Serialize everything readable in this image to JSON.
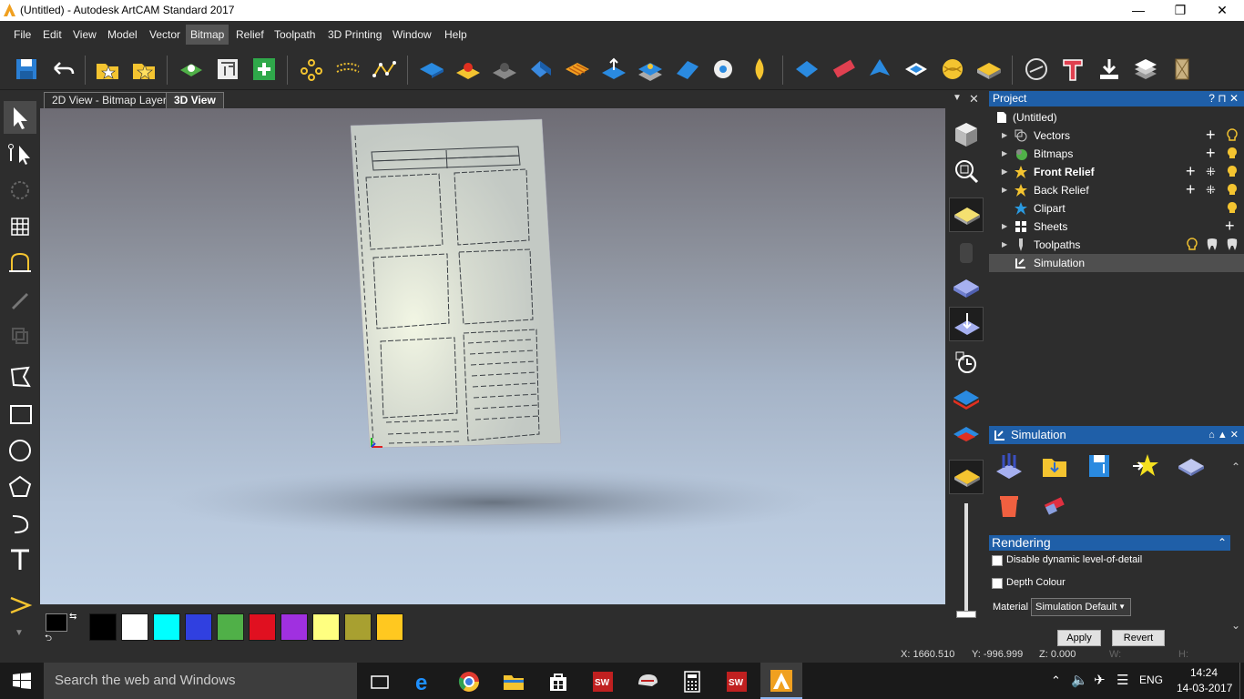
{
  "window": {
    "title": "(Untitled) - Autodesk ArtCAM Standard 2017",
    "minimize": "—",
    "restore": "❐",
    "close": "✕"
  },
  "menu": [
    "File",
    "Edit",
    "View",
    "Model",
    "Vector",
    "Bitmap",
    "Relief",
    "Toolpath",
    "3D Printing",
    "Window",
    "Help"
  ],
  "menu_selected": "Bitmap",
  "tabs": [
    {
      "label": "2D View - Bitmap Layer"
    },
    {
      "label": "3D View"
    }
  ],
  "project": {
    "title": "Project",
    "controls": "? ⊓ ✕",
    "items": [
      {
        "label": "(Untitled)"
      },
      {
        "label": "Vectors"
      },
      {
        "label": "Bitmaps"
      },
      {
        "label": "Front Relief"
      },
      {
        "label": "Back Relief"
      },
      {
        "label": "Clipart"
      },
      {
        "label": "Sheets"
      },
      {
        "label": "Toolpaths"
      },
      {
        "label": "Simulation"
      }
    ]
  },
  "simulation": {
    "title": "Simulation",
    "rendering_title": "Rendering",
    "disable_lod": "Disable dynamic level-of-detail",
    "depth_colour": "Depth Colour",
    "material_label": "Material",
    "material_value": "Simulation Default",
    "apply": "Apply",
    "revert": "Revert"
  },
  "palette": [
    "#000000",
    "#ffffff",
    "#00ffff",
    "#3040e0",
    "#50b048",
    "#e01020",
    "#a030e0",
    "#ffff80",
    "#a8a030",
    "#ffc820"
  ],
  "status": {
    "x": "X: 1660.510",
    "y": "Y: -996.999",
    "z": "Z: 0.000",
    "w": "W:",
    "h": "H:"
  },
  "taskbar": {
    "search": "Search the web and Windows",
    "lang": "ENG",
    "time": "14:24",
    "date": "14-03-2017"
  },
  "accent": "#1f5fa8"
}
